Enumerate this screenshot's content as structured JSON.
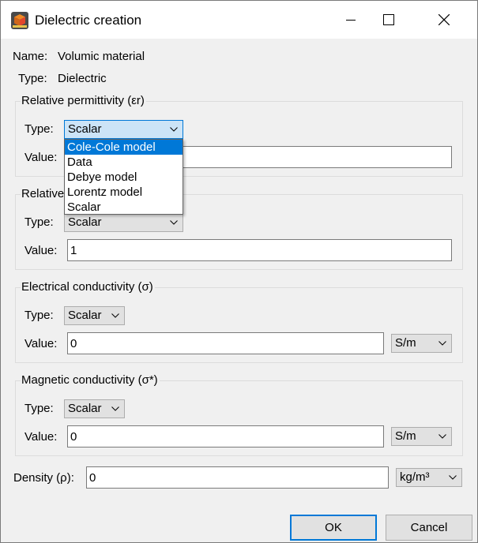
{
  "window": {
    "title": "Dielectric creation",
    "icon": "app-cube-icon"
  },
  "info": {
    "name_label": "Name:",
    "name_value": "Volumic material",
    "type_label": "Type:",
    "type_value": "Dielectric"
  },
  "permittivity": {
    "title": "Relative permittivity (εr)",
    "type_label": "Type:",
    "type_value": "Scalar",
    "value_label": "Value:",
    "value": "",
    "dropdown_open": true,
    "options": [
      "Cole-Cole model",
      "Data",
      "Debye model",
      "Lorentz model",
      "Scalar"
    ],
    "highlighted_option": "Cole-Cole model"
  },
  "permeability": {
    "title_visible_part": "Relative",
    "type_label": "Type:",
    "type_value": "Scalar",
    "value_label": "Value:",
    "value": "1"
  },
  "electrical": {
    "title": "Electrical conductivity (σ)",
    "type_label": "Type:",
    "type_value": "Scalar",
    "value_label": "Value:",
    "value": "0",
    "unit": "S/m"
  },
  "magnetic": {
    "title": "Magnetic conductivity (σ*)",
    "type_label": "Type:",
    "type_value": "Scalar",
    "value_label": "Value:",
    "value": "0",
    "unit": "S/m"
  },
  "density": {
    "label": "Density (ρ):",
    "value": "0",
    "unit": "kg/m³"
  },
  "buttons": {
    "ok": "OK",
    "cancel": "Cancel"
  }
}
